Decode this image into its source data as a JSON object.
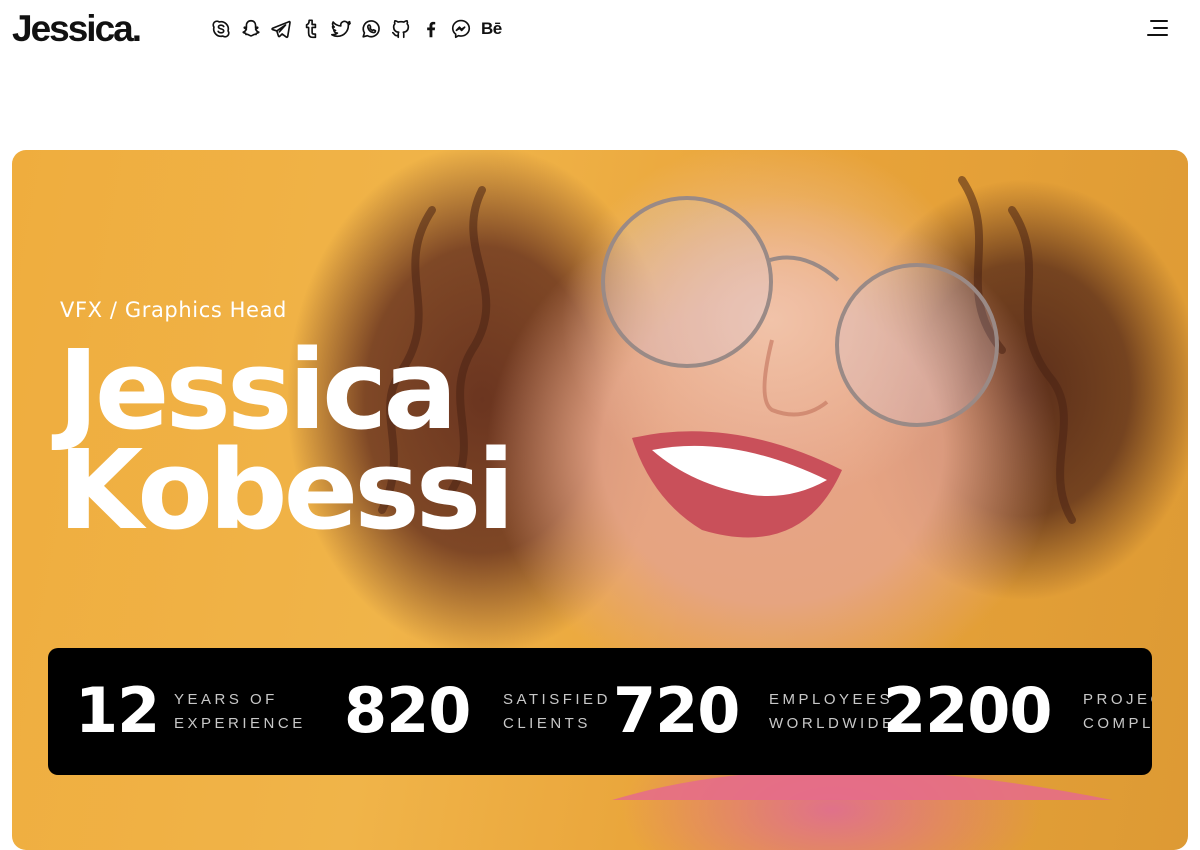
{
  "header": {
    "logo": "Jessica.",
    "social": [
      {
        "icon": "skype-icon"
      },
      {
        "icon": "snapchat-icon"
      },
      {
        "icon": "telegram-icon"
      },
      {
        "icon": "tumblr-icon"
      },
      {
        "icon": "twitter-icon"
      },
      {
        "icon": "whatsapp-icon"
      },
      {
        "icon": "github-icon"
      },
      {
        "icon": "facebook-icon"
      },
      {
        "icon": "messenger-icon"
      },
      {
        "icon": "behance-icon",
        "text": "Bē"
      }
    ],
    "menu_icon": "menu-icon"
  },
  "hero": {
    "tagline": "VFX / Graphics Head",
    "first_name": "Jessica",
    "last_name": "Kobessi",
    "background_color": "#f0b449"
  },
  "stats": [
    {
      "value": "12",
      "line1": "YEARS OF",
      "line2": "EXPERIENCE"
    },
    {
      "value": "820",
      "line1": "SATISFIED",
      "line2": "CLIENTS"
    },
    {
      "value": "720",
      "line1": "EMPLOYEES",
      "line2": "WORLDWIDE"
    },
    {
      "value": "2200",
      "line1": "PROJECTS",
      "line2": "COMPLETED"
    }
  ]
}
